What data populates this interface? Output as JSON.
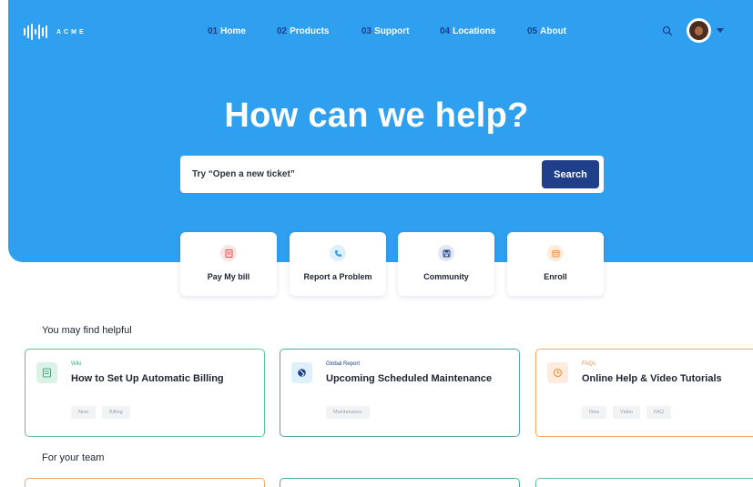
{
  "brand": {
    "name": "ACME",
    "colors": {
      "hero": "#2f9ff0",
      "nav_number": "#1d3f8f",
      "button": "#1f3f8a"
    }
  },
  "nav": {
    "items": [
      {
        "number": "01",
        "label": "Home"
      },
      {
        "number": "02",
        "label": "Products"
      },
      {
        "number": "03",
        "label": "Support"
      },
      {
        "number": "04",
        "label": "Locations"
      },
      {
        "number": "05",
        "label": "About"
      }
    ],
    "search_icon": "search-icon",
    "avatar": "user-avatar",
    "caret_icon": "caret-down-icon"
  },
  "hero": {
    "title": "How can we help?",
    "search_placeholder": "Try “Open a new ticket”",
    "search_button": "Search"
  },
  "quick_actions": [
    {
      "label": "Pay My bill",
      "icon": "bill-icon",
      "color": "#e24a4a"
    },
    {
      "label": "Report a Problem",
      "icon": "phone-icon",
      "color": "#2f9ff0"
    },
    {
      "label": "Community",
      "icon": "save-icon",
      "color": "#1f3f8a"
    },
    {
      "label": "Enroll",
      "icon": "calendar-icon",
      "color": "#f08a3a"
    }
  ],
  "helpful": {
    "title": "You may find helpful",
    "cards": [
      {
        "category": "Wiki",
        "title": "How to Set Up Automatic Billing",
        "tags": [
          "New",
          "Billing"
        ],
        "icon": "document-icon",
        "color": "#3cb27a"
      },
      {
        "category": "Global Report",
        "title": "Upcoming Scheduled Maintenance",
        "tags": [
          "Maintenance"
        ],
        "icon": "globe-icon",
        "color": "#2f9ff0"
      },
      {
        "category": "FAQs",
        "title": "Online Help & Video Tutorials",
        "tags": [
          "New",
          "Video",
          "FAQ"
        ],
        "icon": "clock-icon",
        "color": "#f08a3a"
      }
    ]
  },
  "team": {
    "title": "For your team"
  }
}
